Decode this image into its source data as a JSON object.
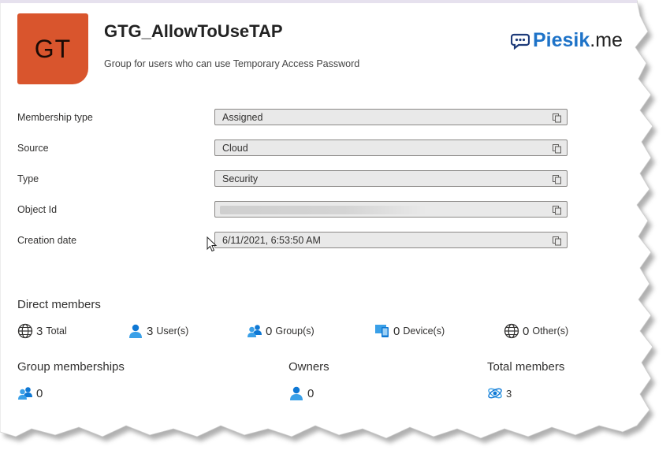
{
  "group": {
    "initials": "GT",
    "name": "GTG_AllowToUseTAP",
    "description": "Group for users who can use Temporary Access Password"
  },
  "brand": {
    "icon": "chat-bubble-icon",
    "part1": "Piesik",
    "part2": ".me",
    "color": "#1e73c8"
  },
  "properties": [
    {
      "label": "Membership type",
      "value": "Assigned"
    },
    {
      "label": "Source",
      "value": "Cloud"
    },
    {
      "label": "Type",
      "value": "Security"
    },
    {
      "label": "Object Id",
      "value": ""
    },
    {
      "label": "Creation date",
      "value": "6/11/2021, 6:53:50 AM"
    }
  ],
  "direct_members": {
    "heading": "Direct members",
    "stats": [
      {
        "icon": "globe-icon",
        "count": "3",
        "label": "Total"
      },
      {
        "icon": "user-icon",
        "count": "3",
        "label": "User(s)"
      },
      {
        "icon": "group-icon",
        "count": "0",
        "label": "Group(s)"
      },
      {
        "icon": "device-icon",
        "count": "0",
        "label": "Device(s)"
      },
      {
        "icon": "globe-icon",
        "count": "0",
        "label": "Other(s)"
      }
    ]
  },
  "summary": {
    "group_memberships": {
      "heading": "Group memberships",
      "icon": "group-icon",
      "count": "0"
    },
    "owners": {
      "heading": "Owners",
      "icon": "user-icon",
      "count": "0"
    },
    "total_members": {
      "heading": "Total members",
      "icon": "members-icon",
      "count": "3"
    }
  },
  "colors": {
    "avatar": "#d9552d",
    "icon_blue": "#0f78d4",
    "field_bg": "#e9e9e9"
  }
}
